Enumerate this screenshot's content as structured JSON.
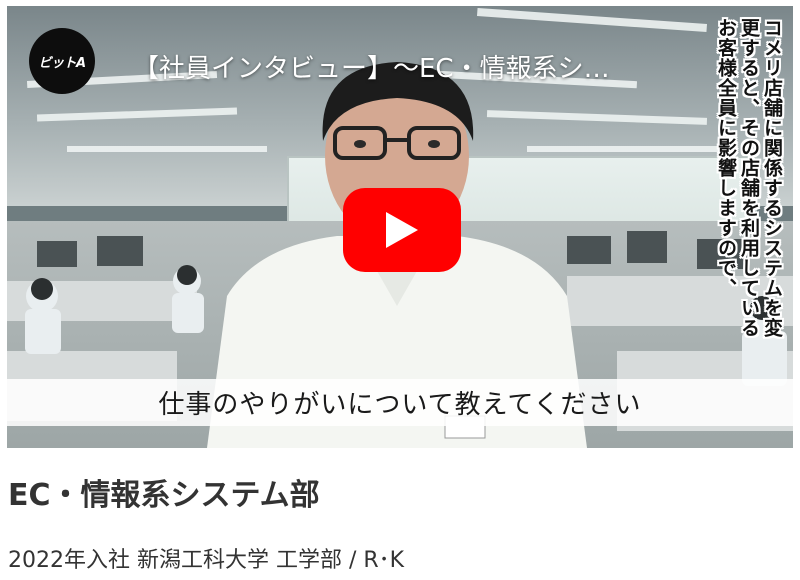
{
  "video": {
    "channel_logo_text": "ビットA",
    "title": "【社員インタビュー】～EC・情報系シ…",
    "vertical_caption": "コメリ店舗に関係するシステムを変更すると、その店舗を利用しているお客様全員に影響しますので、",
    "caption": "仕事のやりがいについて教えてください",
    "play_button_color": "#ff0000"
  },
  "article": {
    "department": "EC・情報系システム部",
    "profile": "2022年入社 新潟工科大学 工学部 / R･K"
  }
}
